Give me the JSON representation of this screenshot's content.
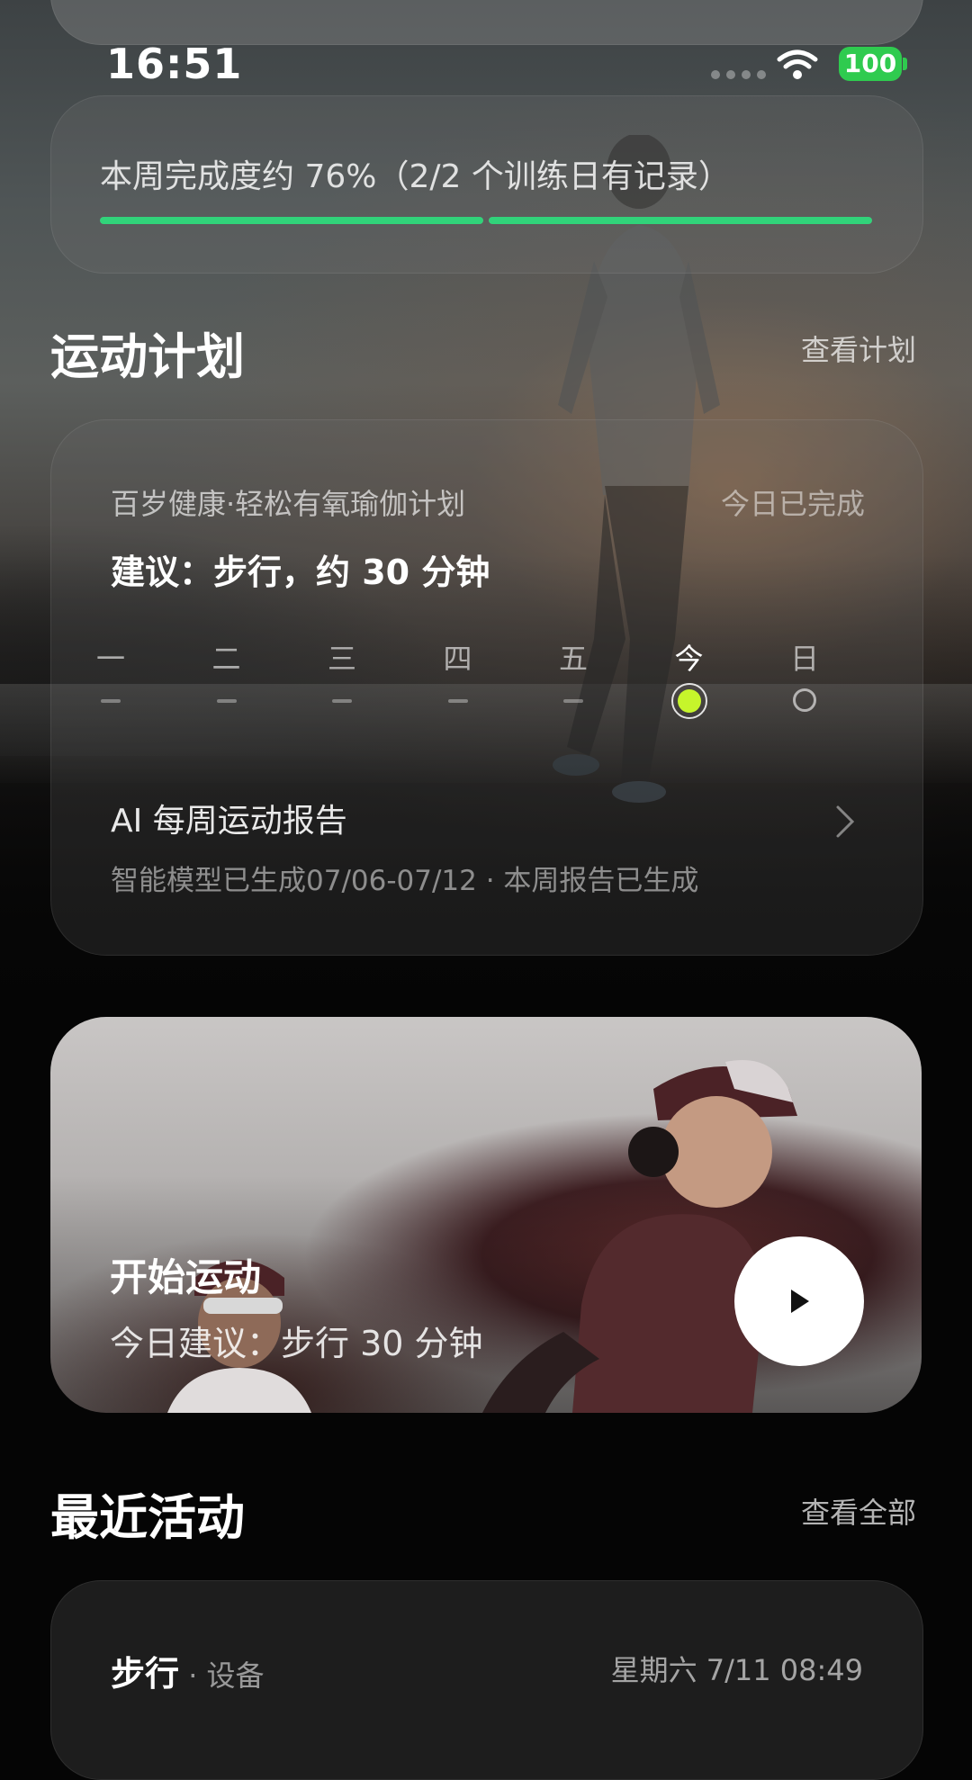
{
  "status_bar": {
    "time": "16:51",
    "battery": "100"
  },
  "weekly_progress": {
    "text": "本周完成度约 76%（2/2 个训练日有记录）",
    "segments": [
      1,
      1
    ],
    "accent": "#31d37a"
  },
  "plan_section": {
    "title": "运动计划",
    "link": "查看计划",
    "card": {
      "plan_name": "百岁健康·轻松有氧瑜伽计划",
      "status": "今日已完成",
      "suggestion": "建议：步行，约 30 分钟",
      "days": [
        {
          "label": "一",
          "state": "none"
        },
        {
          "label": "二",
          "state": "none"
        },
        {
          "label": "三",
          "state": "none"
        },
        {
          "label": "四",
          "state": "none"
        },
        {
          "label": "五",
          "state": "none"
        },
        {
          "label": "今",
          "state": "done"
        },
        {
          "label": "日",
          "state": "pending"
        }
      ],
      "today_color": "#c6f52b",
      "report": {
        "title": "AI 每周运动报告",
        "subtitle": "智能模型已生成07/06-07/12 · 本周报告已生成"
      }
    }
  },
  "start_card": {
    "title": "开始运动",
    "subtitle": "今日建议：步行 30 分钟"
  },
  "recent_section": {
    "title": "最近活动",
    "link": "查看全部",
    "items": [
      {
        "name": "步行",
        "source": " · 设备",
        "time": "星期六 7/11 08:49"
      }
    ]
  }
}
